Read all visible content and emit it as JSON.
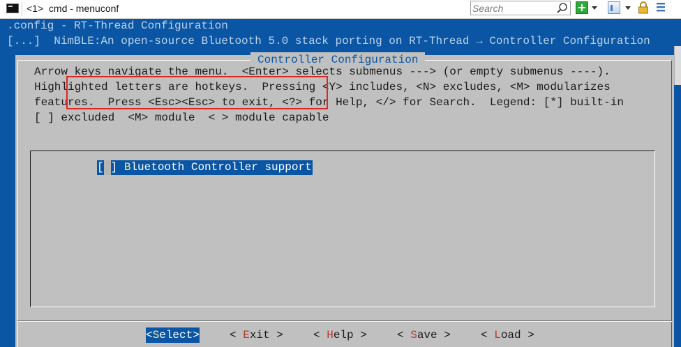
{
  "window": {
    "title": "<1>  cmd - menuconf",
    "search_placeholder": "Search",
    "icons": [
      "console-icon",
      "search-icon",
      "add-console-icon",
      "window-icon",
      "lock-icon",
      "menu-icon"
    ]
  },
  "console": {
    "path_line": ".config - RT-Thread Configuration",
    "breadcrumb_line": "[...]  NimBLE:An open-source Bluetooth 5.0 stack porting on RT-Thread → Controller Configuration"
  },
  "dialog": {
    "title": "Controller Configuration",
    "help_lines": [
      "Arrow keys navigate the menu.  <Enter> selects submenus ---> (or empty submenus ----).",
      "Highlighted letters are hotkeys.  Pressing <Y> includes, <N> excludes, <M> modularizes",
      "features.  Press <Esc><Esc> to exit, <?> for Help, </> for Search.  Legend: [*] built-in",
      "[ ] excluded  <M> module  < > module capable"
    ],
    "items": [
      {
        "checkbox_open": "[",
        "checkbox_close": "] ",
        "hotkey": "B",
        "rest": "luetooth Controller support",
        "selected": true
      }
    ],
    "buttons": [
      {
        "pre": "<",
        "hotkey": "S",
        "rest": "elect>",
        "selected": true
      },
      {
        "pre": "< ",
        "hotkey": "E",
        "rest": "xit >",
        "selected": false
      },
      {
        "pre": "< ",
        "hotkey": "H",
        "rest": "elp >",
        "selected": false
      },
      {
        "pre": "< ",
        "hotkey": "S",
        "rest": "ave >",
        "selected": false
      },
      {
        "pre": "< ",
        "hotkey": "L",
        "rest": "oad >",
        "selected": false
      }
    ]
  },
  "colors": {
    "console_bg": "#0a56a5",
    "dialog_bg": "#c0c0c0",
    "highlight_bg": "#0a56a5",
    "hotkey": "#b53a2a",
    "annotation_box": "#e02424"
  }
}
